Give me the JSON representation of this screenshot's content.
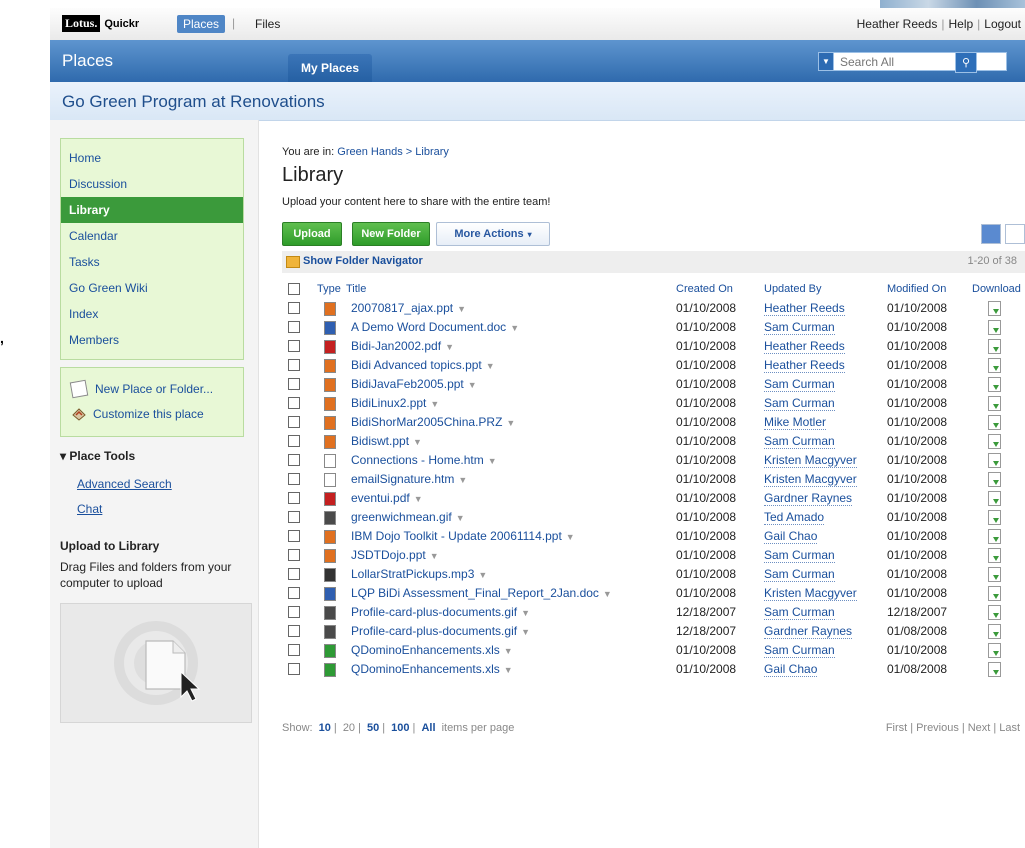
{
  "topbar": {
    "logo_box": "Lotus.",
    "logo_text": "Quickr",
    "tabs": [
      "Places",
      "Files"
    ],
    "user": "Heather Reeds",
    "help": "Help",
    "logout": "Logout"
  },
  "placesbar": {
    "title": "Places",
    "my_places": "My Places",
    "search_placeholder": "Search All"
  },
  "place": {
    "name": "Go Green Program at Renovations"
  },
  "sidebar": {
    "nav": [
      {
        "label": "Home"
      },
      {
        "label": "Discussion"
      },
      {
        "label": "Library"
      },
      {
        "label": "Calendar"
      },
      {
        "label": "Tasks"
      },
      {
        "label": "Go Green Wiki"
      },
      {
        "label": "Index"
      },
      {
        "label": "Members"
      }
    ],
    "actions": {
      "new_place": "New Place or Folder...",
      "customize": "Customize this place"
    },
    "place_tools": "Place Tools",
    "tools": [
      "Advanced Search",
      "Chat"
    ],
    "upload_title": "Upload to Library",
    "upload_desc": "Drag Files and folders from your computer to upload"
  },
  "main": {
    "breadcrumb_prefix": "You are in:",
    "breadcrumb_1": "Green Hands",
    "breadcrumb_sep": ">",
    "breadcrumb_2": "Library",
    "title": "Library",
    "subtitle": "Upload your content here to share with the entire team!",
    "buttons": {
      "upload": "Upload",
      "new_folder": "New Folder",
      "more_actions": "More Actions"
    },
    "folder_navigator": "Show Folder Navigator",
    "page_count": "1-20 of 38",
    "columns": {
      "type": "Type",
      "title": "Title",
      "created": "Created On",
      "updated_by": "Updated By",
      "modified": "Modified On",
      "download": "Download"
    },
    "rows": [
      {
        "name": "20070817_ajax.ppt",
        "created": "01/10/2008",
        "by": "Heather Reeds",
        "modified": "01/10/2008",
        "type_color": "#e0701f"
      },
      {
        "name": "A Demo Word Document.doc",
        "created": "01/10/2008",
        "by": "Sam Curman",
        "modified": "01/10/2008",
        "type_color": "#2f5fb0"
      },
      {
        "name": "Bidi-Jan2002.pdf",
        "created": "01/10/2008",
        "by": "Heather Reeds",
        "modified": "01/10/2008",
        "type_color": "#c42020"
      },
      {
        "name": "Bidi Advanced topics.ppt",
        "created": "01/10/2008",
        "by": "Heather Reeds",
        "modified": "01/10/2008",
        "type_color": "#e0701f"
      },
      {
        "name": "BidiJavaFeb2005.ppt",
        "created": "01/10/2008",
        "by": "Sam Curman",
        "modified": "01/10/2008",
        "type_color": "#e0701f"
      },
      {
        "name": "BidiLinux2.ppt",
        "created": "01/10/2008",
        "by": "Sam Curman",
        "modified": "01/10/2008",
        "type_color": "#e0701f"
      },
      {
        "name": "BidiShorMar2005China.PRZ",
        "created": "01/10/2008",
        "by": "Mike Motler",
        "modified": "01/10/2008",
        "type_color": "#e0701f"
      },
      {
        "name": "Bidiswt.ppt",
        "created": "01/10/2008",
        "by": "Sam Curman",
        "modified": "01/10/2008",
        "type_color": "#e0701f"
      },
      {
        "name": "Connections - Home.htm",
        "created": "01/10/2008",
        "by": "Kristen Macgyver",
        "modified": "01/10/2008",
        "type_color": "#ffffff"
      },
      {
        "name": "emailSignature.htm",
        "created": "01/10/2008",
        "by": "Kristen Macgyver",
        "modified": "01/10/2008",
        "type_color": "#ffffff"
      },
      {
        "name": "eventui.pdf",
        "created": "01/10/2008",
        "by": "Gardner Raynes",
        "modified": "01/10/2008",
        "type_color": "#c42020"
      },
      {
        "name": "greenwichmean.gif",
        "created": "01/10/2008",
        "by": "Ted Amado",
        "modified": "01/10/2008",
        "type_color": "#4a4a4a"
      },
      {
        "name": "IBM Dojo Toolkit - Update 20061114.ppt",
        "created": "01/10/2008",
        "by": "Gail Chao",
        "modified": "01/10/2008",
        "type_color": "#e0701f"
      },
      {
        "name": "JSDTDojo.ppt",
        "created": "01/10/2008",
        "by": "Sam Curman",
        "modified": "01/10/2008",
        "type_color": "#e0701f"
      },
      {
        "name": "LollarStratPickups.mp3",
        "created": "01/10/2008",
        "by": "Sam Curman",
        "modified": "01/10/2008",
        "type_color": "#333333"
      },
      {
        "name": "LQP BiDi Assessment_Final_Report_2Jan.doc",
        "created": "01/10/2008",
        "by": "Kristen Macgyver",
        "modified": "01/10/2008",
        "type_color": "#2f5fb0"
      },
      {
        "name": "Profile-card-plus-documents.gif",
        "created": "12/18/2007",
        "by": "Sam Curman",
        "modified": "12/18/2007",
        "type_color": "#4a4a4a"
      },
      {
        "name": "Profile-card-plus-documents.gif",
        "created": "12/18/2007",
        "by": "Gardner Raynes",
        "modified": "01/08/2008",
        "type_color": "#4a4a4a"
      },
      {
        "name": "QDominoEnhancements.xls",
        "created": "01/10/2008",
        "by": "Sam Curman",
        "modified": "01/10/2008",
        "type_color": "#2e9a35"
      },
      {
        "name": "QDominoEnhancements.xls",
        "created": "01/10/2008",
        "by": "Gail Chao",
        "modified": "01/08/2008",
        "type_color": "#2e9a35"
      }
    ],
    "footer": {
      "show": "Show:",
      "options": [
        "10",
        "20",
        "50",
        "100",
        "All"
      ],
      "suffix": "items per page",
      "pager": [
        "First",
        "Previous",
        "Next",
        "Last"
      ]
    }
  }
}
